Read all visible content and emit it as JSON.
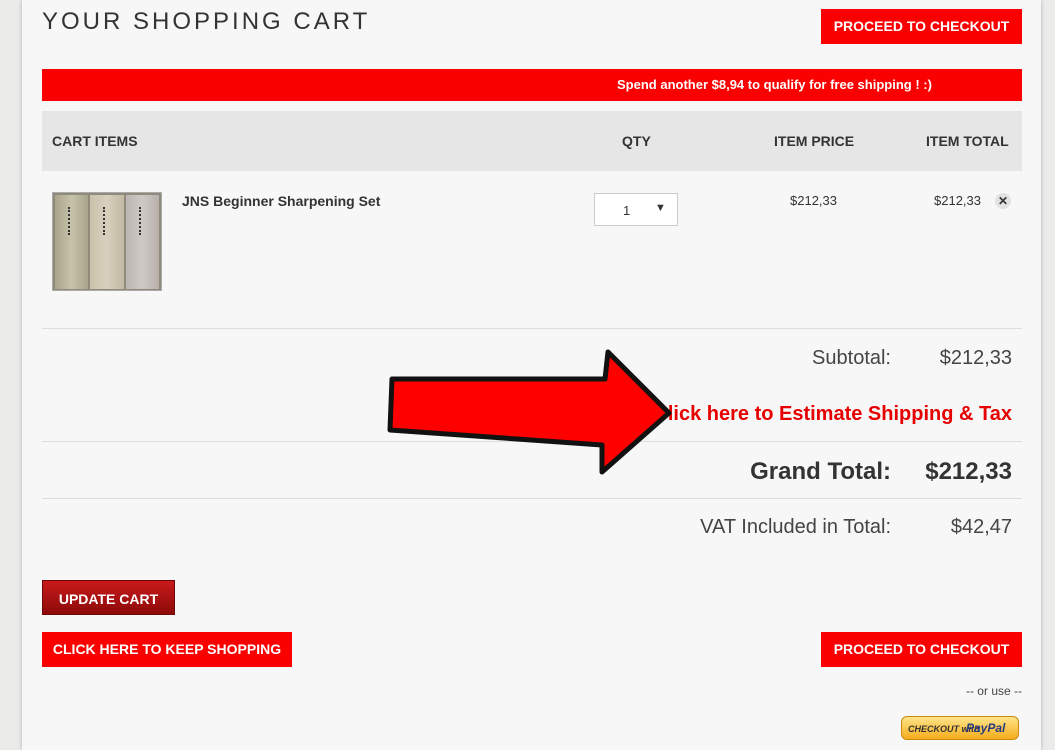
{
  "header": {
    "title": "YOUR SHOPPING CART",
    "checkout_label": "PROCEED TO CHECKOUT"
  },
  "banner": {
    "text": "Spend another $8,94 to qualify for free shipping ! :)"
  },
  "table": {
    "headers": {
      "items": "CART ITEMS",
      "qty": "QTY",
      "price": "ITEM PRICE",
      "total": "ITEM TOTAL"
    },
    "rows": [
      {
        "name": "JNS Beginner Sharpening Set",
        "qty": "1",
        "price": "$212,33",
        "total": "$212,33",
        "remove_icon": "close-icon"
      }
    ]
  },
  "summary": {
    "subtotal_label": "Subtotal:",
    "subtotal_value": "$212,33",
    "estimate_link": "Click here to Estimate Shipping & Tax",
    "grand_label": "Grand Total:",
    "grand_value": "$212,33",
    "vat_label": "VAT Included in Total:",
    "vat_value": "$42,47"
  },
  "footer": {
    "update_label": "UPDATE CART",
    "keep_shopping_label": "CLICK HERE TO KEEP SHOPPING",
    "checkout_label": "PROCEED TO CHECKOUT",
    "or_use": "-- or use --",
    "paypal_prefix": "CHECKOUT with",
    "paypal_brand": "PayPal"
  },
  "colors": {
    "accent": "#fa0000",
    "update_button": "#a81212",
    "annotation_arrow": "#ff0000"
  }
}
